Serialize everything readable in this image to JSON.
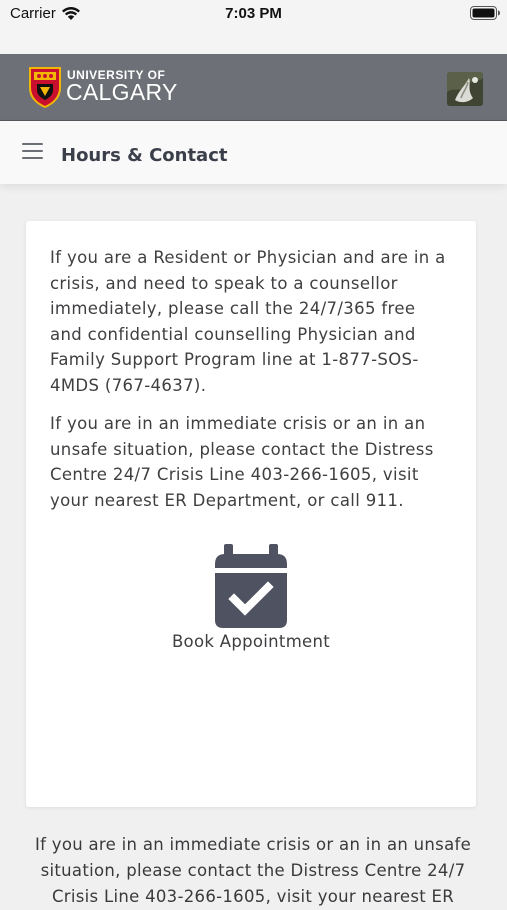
{
  "status_bar": {
    "carrier": "Carrier",
    "time": "7:03 PM"
  },
  "header": {
    "logo_line1": "UNIVERSITY OF",
    "logo_line2": "CALGARY",
    "bg_color": "#6d7076"
  },
  "title_bar": {
    "title": "Hours & Contact"
  },
  "card": {
    "paragraph1": "If you are a Resident or Physician and are in a crisis, and need to speak to a counsellor immediately, please call the 24/7/365 free and confidential counselling Physician and Family Support Program line at 1-877-SOS-4MDS (767-4637).",
    "paragraph2": "If you are in an immediate crisis or an in an unsafe situation, please contact the Distress Centre 24/7 Crisis Line 403-266-1605, visit your nearest ER Department, or call 911.",
    "appointment_icon": "calendar-check-icon",
    "appointment_label": "Book Appointment"
  },
  "footer": {
    "text": "If you are in an immediate crisis or an in an unsafe situation, please contact the Distress Centre 24/7 Crisis Line 403-266-1605, visit your nearest ER"
  }
}
